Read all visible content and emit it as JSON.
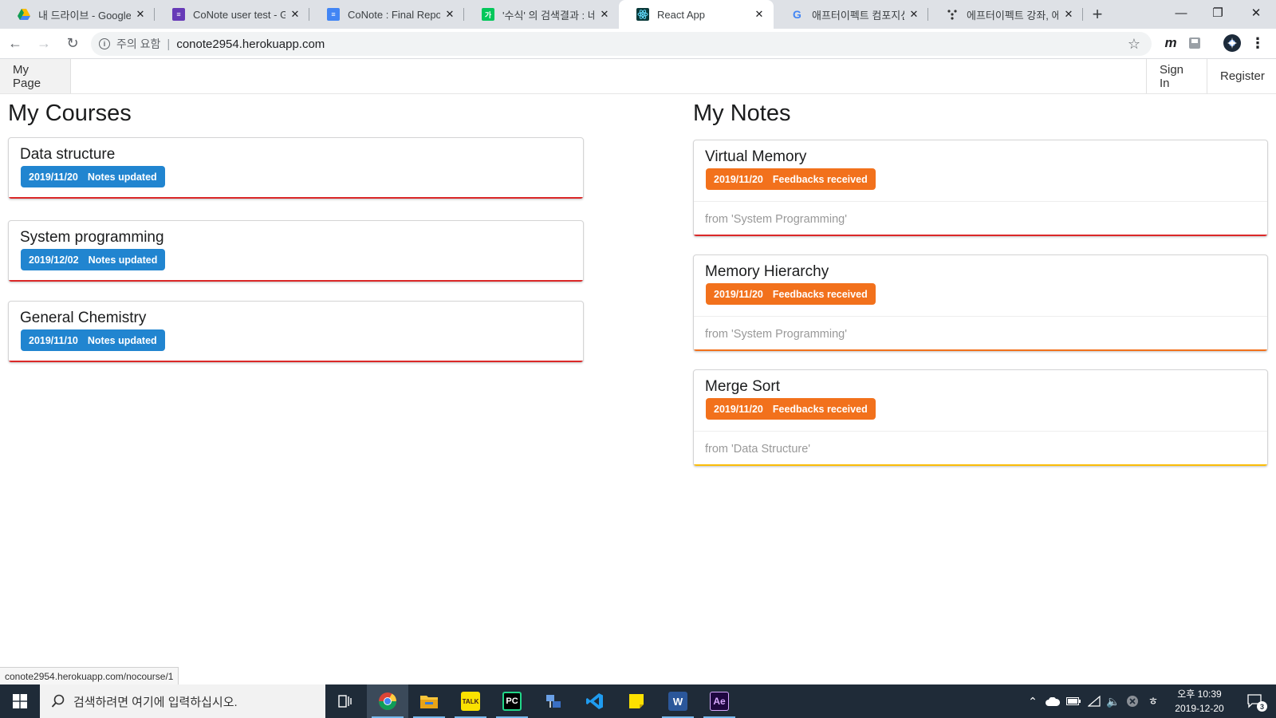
{
  "browser": {
    "tabs": [
      {
        "title": "내 드라이브 - Google",
        "icon": "google-drive-icon",
        "color": "#1fa463"
      },
      {
        "title": "CoNote user test - Go",
        "icon": "google-forms-icon",
        "color": "#673ab7"
      },
      {
        "title": "CoNote : Final Report",
        "icon": "google-docs-icon",
        "color": "#4285f4"
      },
      {
        "title": "'수식' 의 검색결과 : 네",
        "icon": "naver-icon",
        "color": "#03c75a"
      },
      {
        "title": "React App",
        "icon": "react-icon",
        "color": "#0a3a3a"
      },
      {
        "title": "애프터이펙트 컴포지션",
        "icon": "google-icon",
        "color": "#4285f4"
      },
      {
        "title": "에프터이펙트 강좌, 에",
        "icon": "web-icon",
        "color": "#333333"
      }
    ],
    "active_tab_index": 4,
    "new_tab": "+",
    "address": {
      "security_text": "주의 요함",
      "url": "conote2954.herokuapp.com"
    },
    "status_url": "conote2954.herokuapp.com/nocourse/1"
  },
  "app": {
    "nav": {
      "my_page": "My Page",
      "sign_in": "Sign In",
      "register": "Register"
    },
    "courses": {
      "title": "My Courses",
      "items": [
        {
          "name": "Data structure",
          "date": "2019/11/20",
          "status": "Notes updated",
          "accent": "#db2828"
        },
        {
          "name": "System programming",
          "date": "2019/12/02",
          "status": "Notes updated",
          "accent": "#db2828"
        },
        {
          "name": "General Chemistry",
          "date": "2019/11/10",
          "status": "Notes updated",
          "accent": "#db2828"
        }
      ]
    },
    "notes": {
      "title": "My Notes",
      "items": [
        {
          "name": "Virtual Memory",
          "date": "2019/11/20",
          "status": "Feedbacks received",
          "source": "from 'System Programming'",
          "accent": "#db2828"
        },
        {
          "name": "Memory Hierarchy",
          "date": "2019/11/20",
          "status": "Feedbacks received",
          "source": "from 'System Programming'",
          "accent": "#f2711c"
        },
        {
          "name": "Merge Sort",
          "date": "2019/11/20",
          "status": "Feedbacks received",
          "source": "from 'Data Structure'",
          "accent": "#fbbd08"
        }
      ]
    },
    "colors": {
      "label_blue": "#2185d0",
      "label_orange": "#f2711c"
    }
  },
  "taskbar": {
    "search_placeholder": "검색하려면 여기에 입력하십시오.",
    "apps": [
      "task-view-icon",
      "chrome-icon",
      "file-explorer-icon",
      "kakaotalk-icon",
      "pycharm-icon",
      "network-app-icon",
      "vscode-icon",
      "sticky-notes-icon",
      "word-icon",
      "after-effects-icon"
    ],
    "app_labels": {
      "kakaotalk": "TALK",
      "pycharm": "PC",
      "word": "W",
      "after_effects": "Ae"
    },
    "clock": {
      "time": "오후 10:39",
      "date": "2019-12-20"
    },
    "notification_count": "3"
  }
}
